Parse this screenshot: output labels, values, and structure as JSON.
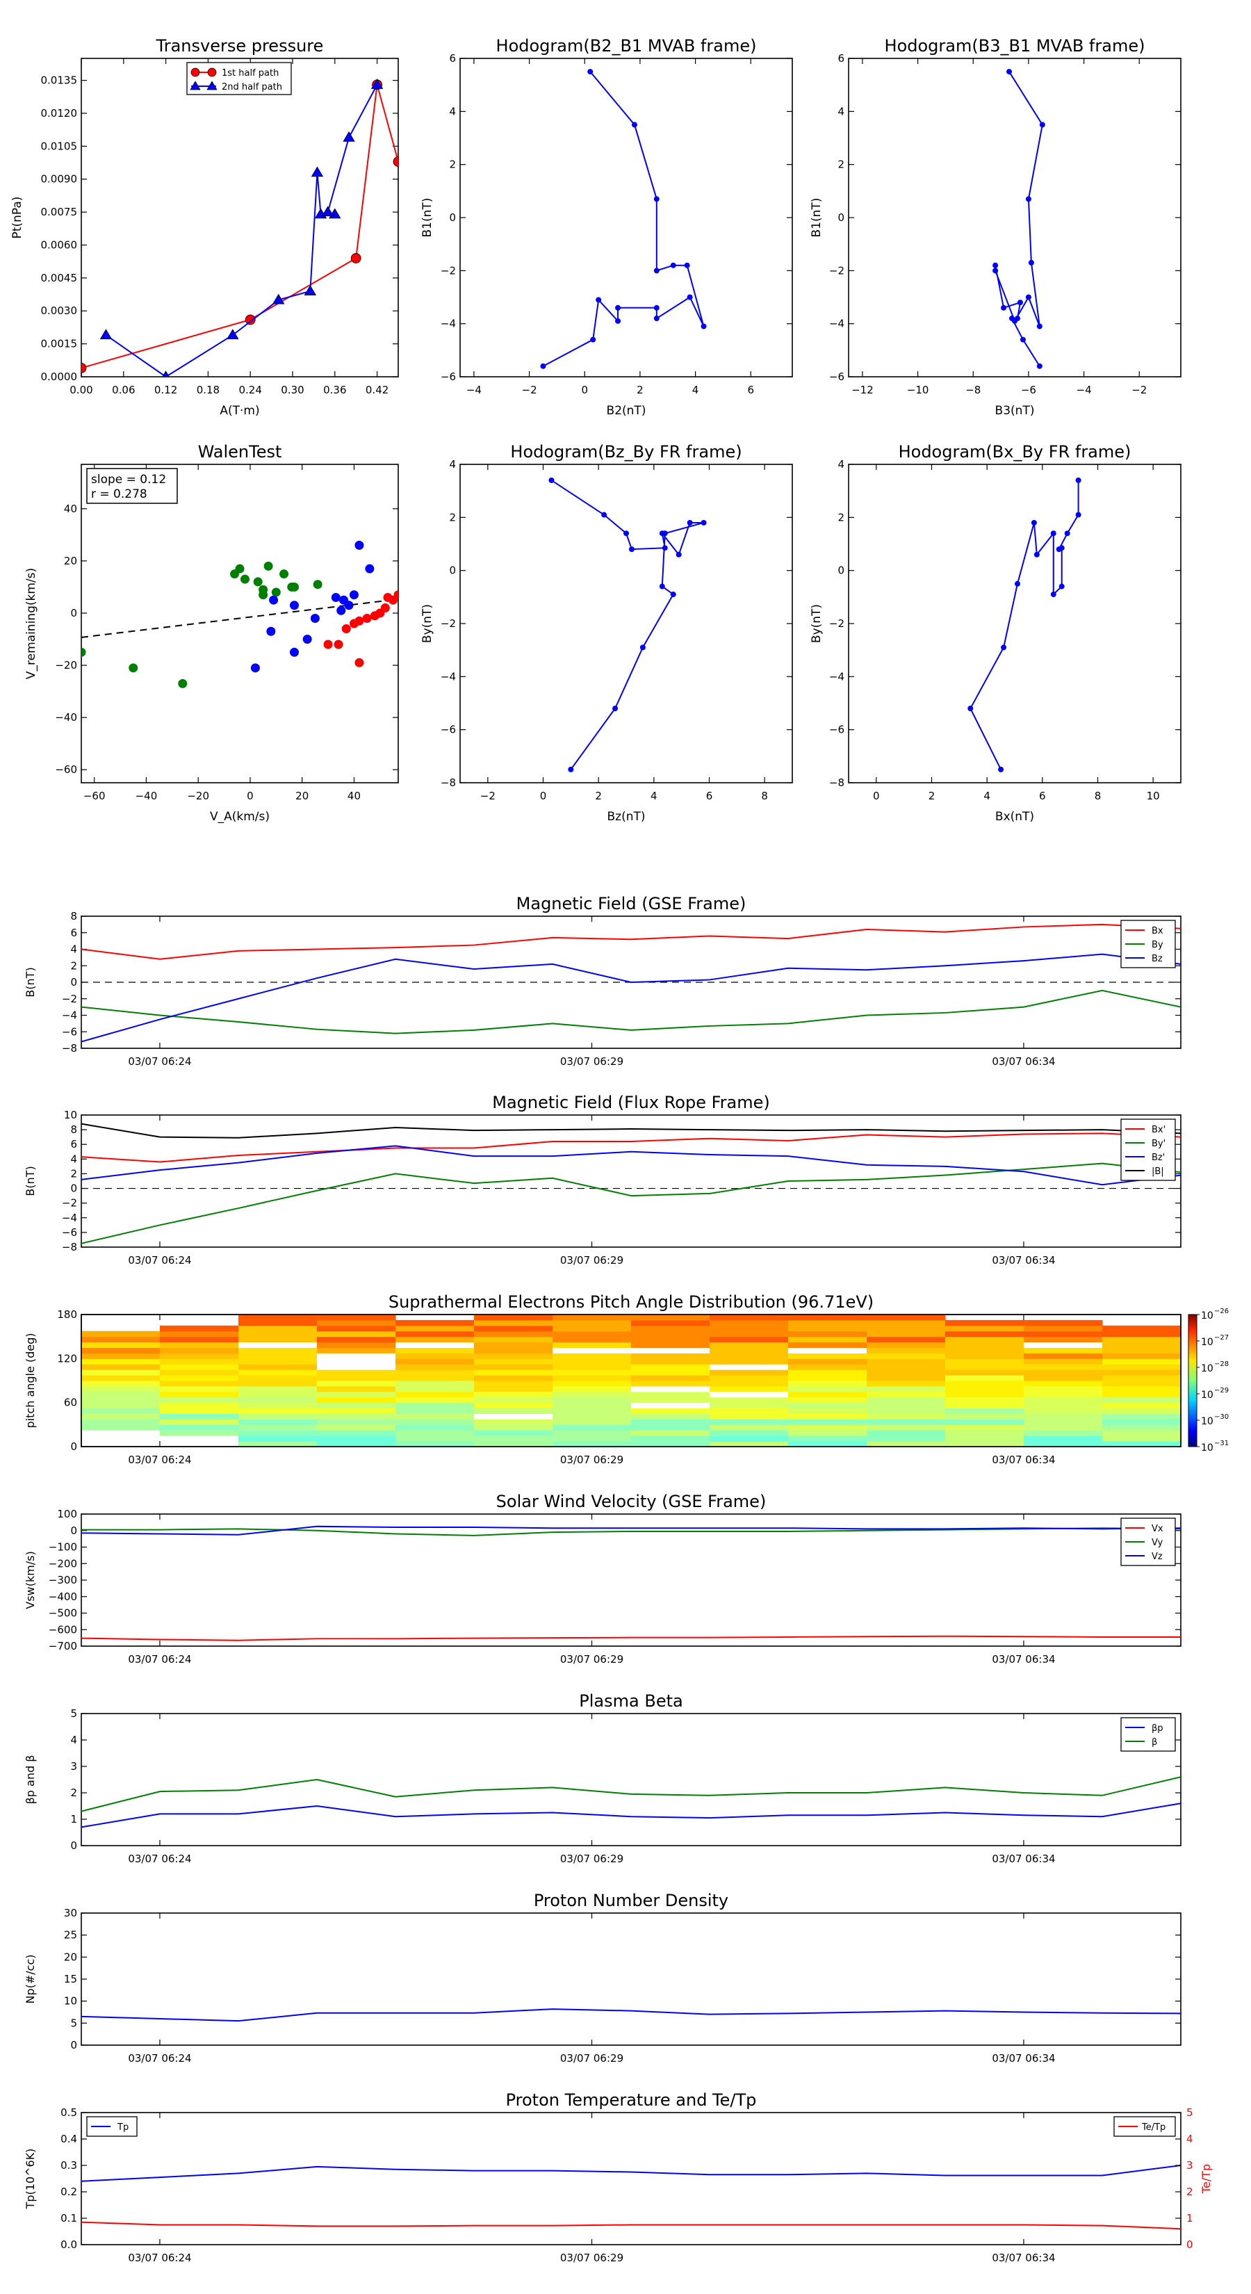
{
  "chart_data": [
    {
      "type": "line",
      "title": "Transverse pressure",
      "xlabel": "A(T·m)",
      "ylabel": "Pt(nPa)",
      "xlim": [
        0,
        0.45
      ],
      "ylim": [
        0,
        0.0145
      ],
      "xticks": [
        "0.00",
        "0.06",
        "0.12",
        "0.18",
        "0.24",
        "0.30",
        "0.36",
        "0.42"
      ],
      "yticks": [
        "0.0000",
        "0.0015",
        "0.0030",
        "0.0045",
        "0.0060",
        "0.0075",
        "0.0090",
        "0.0105",
        "0.0120",
        "0.0135"
      ],
      "legend_position": "top-center",
      "series": [
        {
          "name": "1st half path",
          "color": "#ff0000",
          "marker": "circle",
          "x": [
            0.0,
            0.24,
            0.39,
            0.42,
            0.45
          ],
          "y": [
            0.0004,
            0.0026,
            0.0054,
            0.0133,
            0.0098
          ]
        },
        {
          "name": "2nd half path",
          "color": "#0000ff",
          "marker": "triangle",
          "x": [
            0.035,
            0.12,
            0.215,
            0.28,
            0.325,
            0.335,
            0.34,
            0.36,
            0.35,
            0.38,
            0.42
          ],
          "y": [
            0.0019,
            0.0,
            0.0019,
            0.0035,
            0.0039,
            0.0093,
            0.0074,
            0.0074,
            0.0075,
            0.0109,
            0.0133
          ]
        }
      ]
    },
    {
      "type": "line",
      "title": "Hodogram(B2_B1 MVAB frame)",
      "xlabel": "B2(nT)",
      "ylabel": "B1(nT)",
      "xlim": [
        -4.5,
        7.5
      ],
      "ylim": [
        -6,
        6
      ],
      "xticks": [
        "−4",
        "−2",
        "0",
        "2",
        "4",
        "6"
      ],
      "yticks": [
        "−6",
        "−4",
        "−2",
        "0",
        "2",
        "4",
        "6"
      ],
      "series": [
        {
          "color": "#0000ff",
          "x": [
            0.2,
            1.8,
            2.6,
            2.6,
            3.2,
            3.7,
            4.3,
            3.8,
            2.6,
            2.6,
            1.2,
            1.2,
            0.5,
            0.3,
            -1.5
          ],
          "y": [
            5.5,
            3.5,
            0.7,
            -2.0,
            -1.8,
            -1.8,
            -4.1,
            -3.0,
            -3.8,
            -3.4,
            -3.4,
            -3.9,
            -3.1,
            -4.6,
            -5.6
          ]
        }
      ]
    },
    {
      "type": "line",
      "title": "Hodogram(B3_B1 MVAB frame)",
      "xlabel": "B3(nT)",
      "ylabel": "B1(nT)",
      "xlim": [
        -12.5,
        -0.5
      ],
      "ylim": [
        -6,
        6
      ],
      "xticks": [
        "−12",
        "−10",
        "−8",
        "−6",
        "−4",
        "−2"
      ],
      "yticks": [
        "−6",
        "−4",
        "−2",
        "0",
        "2",
        "4",
        "6"
      ],
      "series": [
        {
          "color": "#0000ff",
          "x": [
            -6.7,
            -5.5,
            -6.0,
            -5.9,
            -5.6,
            -6.0,
            -6.5,
            -7.2,
            -7.2,
            -6.9,
            -6.3,
            -6.4,
            -6.6,
            -6.2,
            -5.6
          ],
          "y": [
            5.5,
            3.5,
            0.7,
            -1.7,
            -4.1,
            -3.0,
            -3.9,
            -2.0,
            -1.8,
            -3.4,
            -3.2,
            -3.8,
            -3.8,
            -4.6,
            -5.6
          ]
        }
      ]
    },
    {
      "type": "scatter",
      "title": "WalenTest",
      "xlabel": "V_A(km/s)",
      "ylabel": "V_remaining(km/s)",
      "xlim": [
        -65,
        57
      ],
      "ylim": [
        -65,
        57
      ],
      "xticks": [
        "−60",
        "−40",
        "−20",
        "0",
        "20",
        "40"
      ],
      "yticks": [
        "−60",
        "−40",
        "−20",
        "0",
        "20",
        "40"
      ],
      "annotation": [
        "slope = 0.12",
        "r = 0.278"
      ],
      "fit_line": {
        "slope": 0.12,
        "intercept": -1.5
      },
      "series": [
        {
          "color": "#008000",
          "x": [
            -65,
            -45,
            -26,
            -6,
            -4,
            -2,
            3,
            5,
            5,
            7,
            10,
            13,
            16,
            17,
            26
          ],
          "y": [
            -15,
            -21,
            -27,
            15,
            17,
            13,
            12,
            7,
            9,
            18,
            8,
            15,
            10,
            10,
            11
          ]
        },
        {
          "color": "#0000ff",
          "x": [
            2,
            8,
            9,
            17,
            17,
            22,
            25,
            33,
            35,
            36,
            38,
            40,
            42,
            46
          ],
          "y": [
            -21,
            -7,
            5,
            -15,
            3,
            -10,
            -2,
            6,
            1,
            5,
            3,
            7,
            26,
            17
          ]
        },
        {
          "color": "#ff0000",
          "x": [
            30,
            34,
            37,
            40,
            42,
            45,
            48,
            50,
            52,
            53,
            55,
            57
          ],
          "y": [
            -12,
            -12,
            -6,
            -4,
            -3,
            -2,
            -1,
            0,
            2,
            6,
            5,
            7
          ]
        },
        {
          "color": "#ff0000",
          "x": [
            42
          ],
          "y": [
            -19
          ]
        }
      ]
    },
    {
      "type": "line",
      "title": "Hodogram(Bz_By FR frame)",
      "xlabel": "Bz(nT)",
      "ylabel": "By(nT)",
      "xlim": [
        -3,
        9
      ],
      "ylim": [
        -8,
        4
      ],
      "xticks": [
        "−2",
        "0",
        "2",
        "4",
        "6",
        "8"
      ],
      "yticks": [
        "−8",
        "−6",
        "−4",
        "−2",
        "0",
        "2",
        "4"
      ],
      "series": [
        {
          "color": "#0000ff",
          "x": [
            0.3,
            2.2,
            3.0,
            3.2,
            4.4,
            4.3,
            4.9,
            5.3,
            5.8,
            4.4,
            4.3,
            4.7,
            3.6,
            2.6,
            1.0
          ],
          "y": [
            3.4,
            2.1,
            1.4,
            0.8,
            0.85,
            1.4,
            0.6,
            1.8,
            1.8,
            1.4,
            -0.6,
            -0.9,
            -2.9,
            -5.2,
            -7.5
          ]
        }
      ]
    },
    {
      "type": "line",
      "title": "Hodogram(Bx_By FR frame)",
      "xlabel": "Bx(nT)",
      "ylabel": "By(nT)",
      "xlim": [
        -1,
        11
      ],
      "ylim": [
        -8,
        4
      ],
      "xticks": [
        "0",
        "2",
        "4",
        "6",
        "8",
        "10"
      ],
      "yticks": [
        "−8",
        "−6",
        "−4",
        "−2",
        "0",
        "2",
        "4"
      ],
      "series": [
        {
          "color": "#0000ff",
          "x": [
            7.3,
            7.3,
            6.9,
            6.6,
            6.7,
            6.7,
            6.4,
            6.4,
            5.8,
            5.7,
            5.1,
            4.6,
            3.4,
            4.5
          ],
          "y": [
            3.4,
            2.1,
            1.4,
            0.8,
            0.85,
            -0.6,
            -0.9,
            1.4,
            0.6,
            1.8,
            -0.5,
            -2.9,
            -5.2,
            -7.5
          ]
        }
      ]
    },
    {
      "type": "line",
      "title": "Magnetic Field (GSE Frame)",
      "ylabel": "B(nT)",
      "ylim": [
        -8,
        8
      ],
      "yticks": [
        "−8",
        "−6",
        "−4",
        "−2",
        "0",
        "2",
        "4",
        "6",
        "8"
      ],
      "xticks": [
        "03/07 06:24",
        "03/07 06:29",
        "03/07 06:34"
      ],
      "legend_position": "right",
      "zero_line": true,
      "series": [
        {
          "name": "Bx",
          "color": "#ff0000",
          "values": [
            4.0,
            2.8,
            3.8,
            4.0,
            4.2,
            4.5,
            5.4,
            5.2,
            5.6,
            5.3,
            6.4,
            6.1,
            6.7,
            7.0,
            6.5
          ]
        },
        {
          "name": "By",
          "color": "#008000",
          "values": [
            -3.0,
            -4.0,
            -4.8,
            -5.7,
            -6.2,
            -5.8,
            -5.0,
            -5.8,
            -5.3,
            -5.0,
            -4.0,
            -3.7,
            -3.0,
            -1.0,
            -3.0
          ]
        },
        {
          "name": "Bz",
          "color": "#0000ff",
          "values": [
            -7.2,
            -4.5,
            -2.0,
            0.5,
            2.8,
            1.6,
            2.2,
            0.0,
            0.3,
            1.7,
            1.5,
            2.0,
            2.6,
            3.4,
            2.2
          ]
        }
      ]
    },
    {
      "type": "line",
      "title": "Magnetic Field (Flux Rope Frame)",
      "ylabel": "B(nT)",
      "ylim": [
        -8,
        10
      ],
      "yticks": [
        "−8",
        "−6",
        "−4",
        "−2",
        "0",
        "2",
        "4",
        "6",
        "8",
        "10"
      ],
      "xticks": [
        "03/07 06:24",
        "03/07 06:29",
        "03/07 06:34"
      ],
      "legend_position": "right",
      "zero_line": true,
      "series": [
        {
          "name": "Bx'",
          "color": "#ff0000",
          "values": [
            4.3,
            3.6,
            4.5,
            5.0,
            5.5,
            5.5,
            6.4,
            6.4,
            6.8,
            6.5,
            7.3,
            7.0,
            7.4,
            7.5,
            7.0
          ]
        },
        {
          "name": "By'",
          "color": "#008000",
          "values": [
            -7.5,
            -5.0,
            -2.7,
            -0.3,
            2.0,
            0.7,
            1.4,
            -1.0,
            -0.7,
            1.0,
            1.2,
            1.8,
            2.6,
            3.4,
            2.2
          ]
        },
        {
          "name": "Bz'",
          "color": "#0000ff",
          "values": [
            1.2,
            2.5,
            3.5,
            4.8,
            5.8,
            4.4,
            4.4,
            5.0,
            4.6,
            4.4,
            3.2,
            3.0,
            2.3,
            0.5,
            1.8
          ]
        },
        {
          "name": "|B|",
          "color": "#000000",
          "values": [
            8.8,
            7.0,
            6.9,
            7.5,
            8.3,
            7.9,
            8.0,
            8.1,
            8.0,
            7.9,
            8.0,
            7.8,
            7.9,
            8.0,
            7.5
          ]
        }
      ]
    },
    {
      "type": "heatmap",
      "title": "Suprathermal Electrons Pitch Angle Distribution (96.71eV)",
      "ylabel": "pitch angle (deg)",
      "ylim": [
        0,
        180
      ],
      "yticks": [
        "0",
        "60",
        "120",
        "180"
      ],
      "xticks": [
        "03/07 06:24",
        "03/07 06:29",
        "03/07 06:34"
      ],
      "colorbar": {
        "min_exp": -31,
        "max_exp": -26,
        "labels": [
          "10",
          "10",
          "10",
          "10",
          "10",
          "10"
        ],
        "exponents": [
          "−31",
          "−30",
          "−29",
          "−28",
          "−27",
          "−26"
        ]
      }
    },
    {
      "type": "line",
      "title": "Solar Wind Velocity (GSE Frame)",
      "ylabel": "Vsw(km/s)",
      "ylim": [
        -700,
        100
      ],
      "yticks": [
        "−700",
        "−600",
        "−500",
        "−400",
        "−300",
        "−200",
        "−100",
        "0",
        "100"
      ],
      "xticks": [
        "03/07 06:24",
        "03/07 06:29",
        "03/07 06:34"
      ],
      "legend_position": "right",
      "series": [
        {
          "name": "Vx",
          "color": "#ff0000",
          "values": [
            -652,
            -660,
            -665,
            -655,
            -655,
            -652,
            -650,
            -648,
            -648,
            -645,
            -642,
            -640,
            -642,
            -645,
            -645
          ]
        },
        {
          "name": "Vy",
          "color": "#008000",
          "values": [
            5,
            5,
            10,
            0,
            -20,
            -30,
            -10,
            -5,
            -5,
            -5,
            0,
            5,
            10,
            15,
            10
          ]
        },
        {
          "name": "Vz",
          "color": "#0000ff",
          "values": [
            -15,
            -20,
            -25,
            25,
            20,
            20,
            15,
            15,
            15,
            15,
            10,
            10,
            15,
            10,
            15
          ]
        }
      ]
    },
    {
      "type": "line",
      "title": "Plasma Beta",
      "ylabel": "βp and β",
      "ylim": [
        0,
        5
      ],
      "yticks": [
        "0",
        "1",
        "2",
        "3",
        "4",
        "5"
      ],
      "xticks": [
        "03/07 06:24",
        "03/07 06:29",
        "03/07 06:34"
      ],
      "legend_position": "top-right",
      "series": [
        {
          "name": "βp",
          "color": "#0000ff",
          "values": [
            0.7,
            1.2,
            1.2,
            1.5,
            1.1,
            1.2,
            1.25,
            1.1,
            1.05,
            1.15,
            1.15,
            1.25,
            1.15,
            1.1,
            1.6
          ]
        },
        {
          "name": "β",
          "color": "#008000",
          "values": [
            1.3,
            2.05,
            2.1,
            2.5,
            1.85,
            2.1,
            2.2,
            1.95,
            1.9,
            2.0,
            2.0,
            2.2,
            2.0,
            1.9,
            2.6
          ]
        }
      ]
    },
    {
      "type": "line",
      "title": "Proton Number Density",
      "ylabel": "Np(#/cc)",
      "ylim": [
        0,
        30
      ],
      "yticks": [
        "0",
        "5",
        "10",
        "15",
        "20",
        "25",
        "30"
      ],
      "xticks": [
        "03/07 06:24",
        "03/07 06:29",
        "03/07 06:34"
      ],
      "series": [
        {
          "name": "Np",
          "color": "#0000ff",
          "values": [
            6.5,
            6.0,
            5.5,
            7.3,
            7.3,
            7.3,
            8.2,
            7.8,
            7.0,
            7.2,
            7.5,
            7.8,
            7.5,
            7.3,
            7.2
          ]
        }
      ]
    },
    {
      "type": "line",
      "title": "Proton Temperature and Te/Tp",
      "ylabel": "Tp(10^6K)",
      "ylabel_right": "Te/Tp",
      "ylim": [
        0,
        0.5
      ],
      "ylim_right": [
        0,
        5
      ],
      "yticks": [
        "0.0",
        "0.1",
        "0.2",
        "0.3",
        "0.4",
        "0.5"
      ],
      "yticks_right": [
        "0",
        "1",
        "2",
        "3",
        "4",
        "5"
      ],
      "xticks": [
        "03/07 06:24",
        "03/07 06:29",
        "03/07 06:34"
      ],
      "series": [
        {
          "name": "Tp",
          "color": "#0000ff",
          "axis": "left",
          "values": [
            0.24,
            0.255,
            0.27,
            0.295,
            0.285,
            0.28,
            0.28,
            0.275,
            0.265,
            0.265,
            0.27,
            0.262,
            0.262,
            0.262,
            0.3
          ]
        },
        {
          "name": "Te/Tp",
          "color": "#ff0000",
          "axis": "right",
          "values": [
            0.85,
            0.75,
            0.75,
            0.7,
            0.7,
            0.72,
            0.72,
            0.75,
            0.75,
            0.75,
            0.75,
            0.75,
            0.75,
            0.72,
            0.6
          ]
        }
      ]
    }
  ]
}
